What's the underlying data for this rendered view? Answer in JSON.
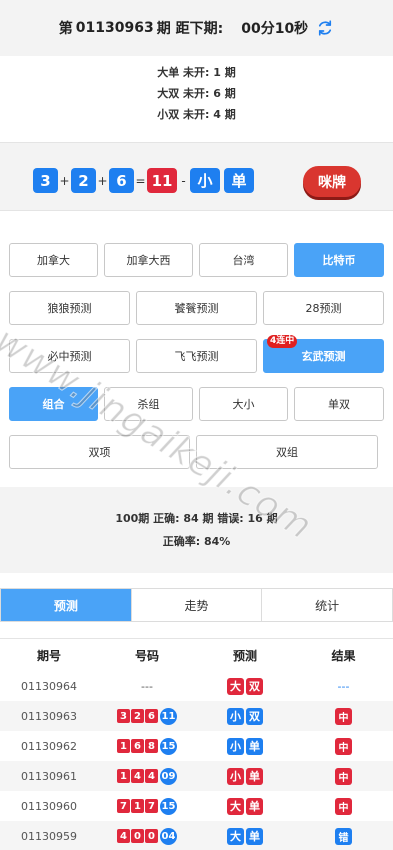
{
  "header": {
    "prefix": "第",
    "issue": "01130963",
    "suffix": "期 距下期:",
    "countdown": "00分10秒",
    "refresh_icon": "refresh-icon",
    "accent": "#1e7ff0"
  },
  "missing": [
    "大单 未开: 1 期",
    "大双 未开: 6 期",
    "小双 未开: 4 期"
  ],
  "result": {
    "n1": "3",
    "n2": "2",
    "n3": "6",
    "sum": "11",
    "size": "小",
    "parity": "单",
    "plus": "+",
    "eq": "=",
    "dash": "-"
  },
  "mipai": "咪牌",
  "games": [
    "加拿大",
    "加拿大西",
    "台湾",
    "比特币"
  ],
  "predictors": [
    "狼狼预测",
    "饕餮预测",
    "28预测",
    "必中预测",
    "飞飞预测",
    "玄武预测"
  ],
  "predictor_badge": "4连中",
  "types": [
    "组合",
    "杀组",
    "大小",
    "单双",
    "双项",
    "双组"
  ],
  "stats": {
    "line1": "100期 正确: 84 期 错误: 16 期",
    "line2": "正确率: 84%"
  },
  "tabs": [
    "预测",
    "走势",
    "统计"
  ],
  "table": {
    "headers": [
      "期号",
      "号码",
      "预测",
      "结果"
    ],
    "rows": [
      {
        "issue": "01130964",
        "nums": [],
        "sum": "",
        "pending": "---",
        "pred": [
          "大",
          "双"
        ],
        "pred_colors": [
          "red",
          "red"
        ],
        "result": "---",
        "result_color": "dash"
      },
      {
        "issue": "01130963",
        "nums": [
          "3",
          "2",
          "6"
        ],
        "sum": "11",
        "pred": [
          "小",
          "双"
        ],
        "pred_colors": [
          "blue",
          "blue"
        ],
        "result": "中",
        "result_color": "red"
      },
      {
        "issue": "01130962",
        "nums": [
          "1",
          "6",
          "8"
        ],
        "sum": "15",
        "pred": [
          "小",
          "单"
        ],
        "pred_colors": [
          "blue",
          "blue"
        ],
        "result": "中",
        "result_color": "red"
      },
      {
        "issue": "01130961",
        "nums": [
          "1",
          "4",
          "4"
        ],
        "sum": "09",
        "pred": [
          "小",
          "单"
        ],
        "pred_colors": [
          "red",
          "red"
        ],
        "result": "中",
        "result_color": "red"
      },
      {
        "issue": "01130960",
        "nums": [
          "7",
          "1",
          "7"
        ],
        "sum": "15",
        "pred": [
          "大",
          "单"
        ],
        "pred_colors": [
          "red",
          "red"
        ],
        "result": "中",
        "result_color": "red"
      },
      {
        "issue": "01130959",
        "nums": [
          "4",
          "0",
          "0"
        ],
        "sum": "04",
        "pred": [
          "大",
          "单"
        ],
        "pred_colors": [
          "blue",
          "blue"
        ],
        "result": "错",
        "result_color": "blue"
      }
    ]
  },
  "watermark": "www.jingaikeji.com"
}
